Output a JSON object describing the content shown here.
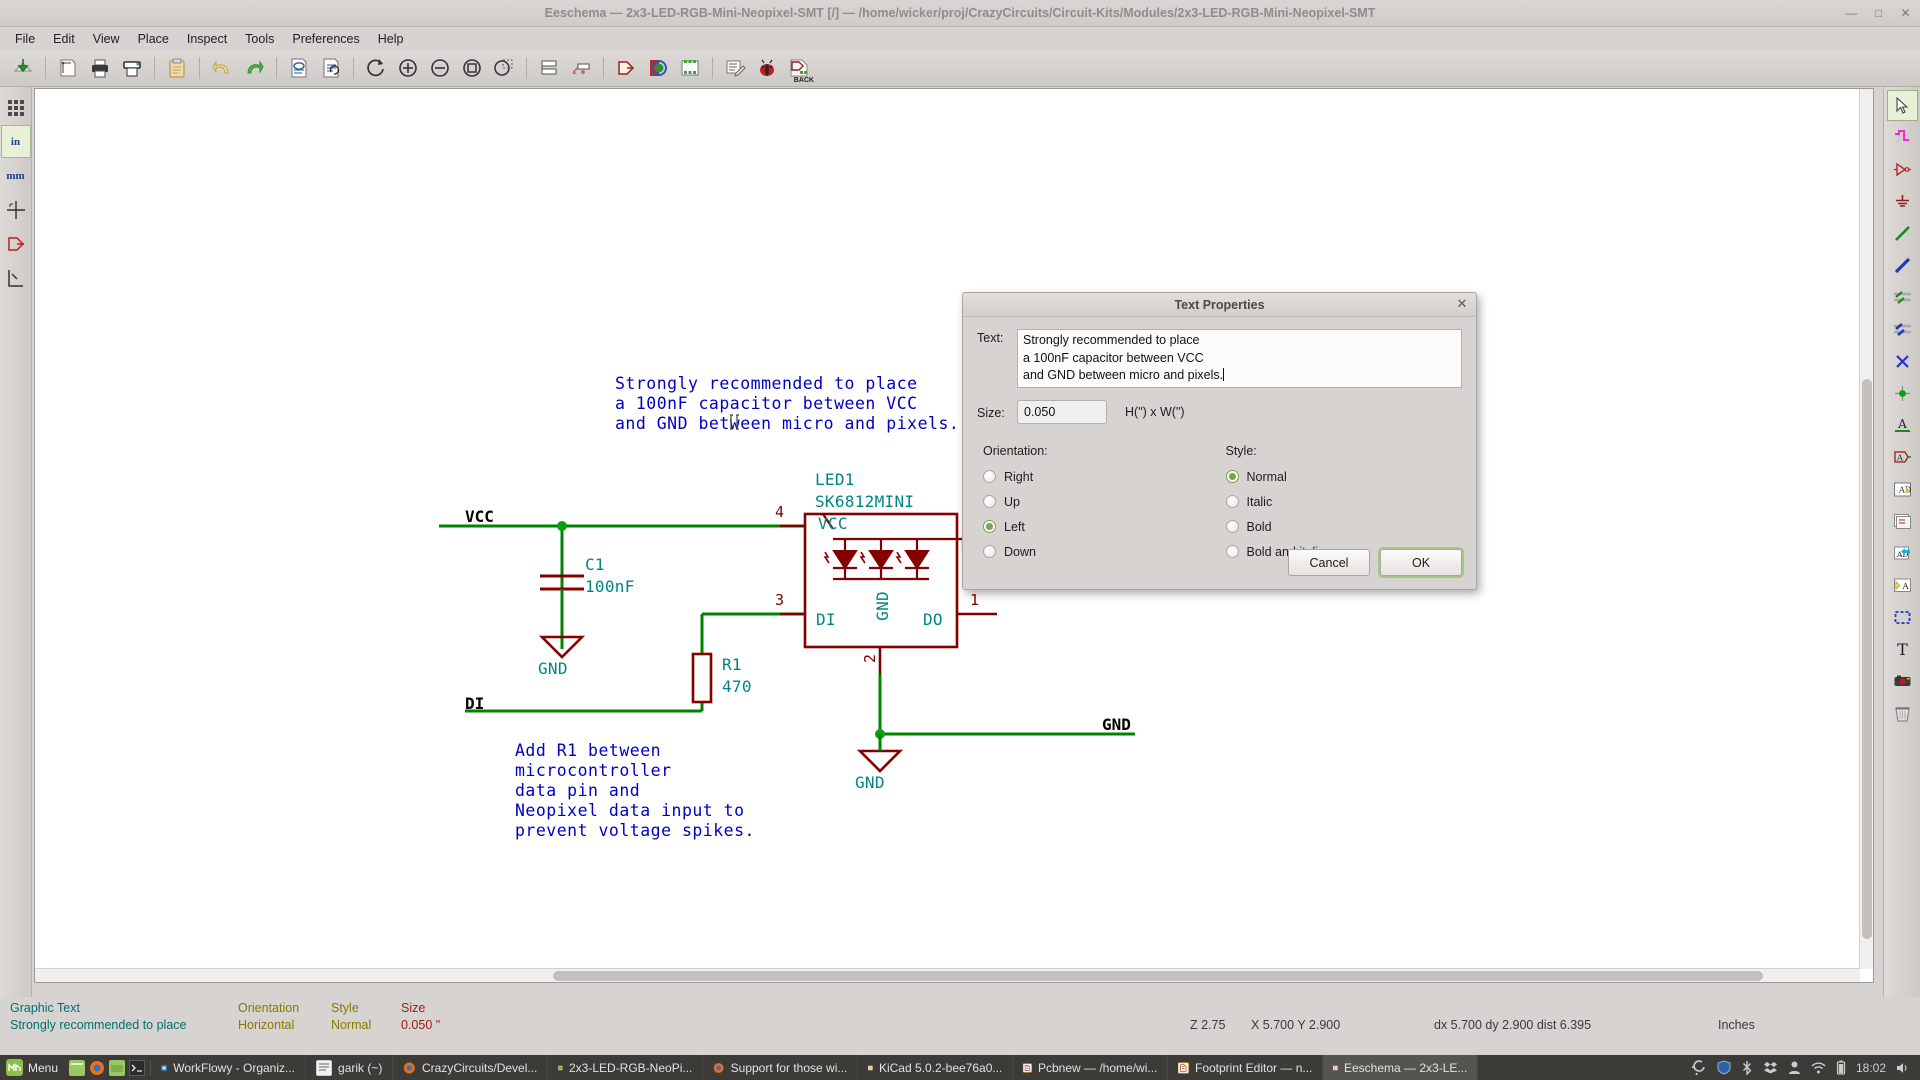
{
  "window": {
    "title": "Eeschema — 2x3-LED-RGB-Mini-Neopixel-SMT [/] — /home/wicker/proj/CrazyCircuits/Circuit-Kits/Modules/2x3-LED-RGB-Mini-Neopixel-SMT",
    "minimize": "—",
    "maximize": "□",
    "close": "✕"
  },
  "menubar": {
    "items": [
      {
        "label": "File"
      },
      {
        "label": "Edit"
      },
      {
        "label": "View"
      },
      {
        "label": "Place"
      },
      {
        "label": "Inspect"
      },
      {
        "label": "Tools"
      },
      {
        "label": "Preferences"
      },
      {
        "label": "Help"
      }
    ]
  },
  "toolbar": {
    "buttons": [
      {
        "name": "new-sheet-icon",
        "tip": "New Schematic"
      },
      {
        "name": "page-settings-icon",
        "tip": "Page Settings"
      },
      {
        "name": "print-icon",
        "tip": "Print Schematic"
      },
      {
        "name": "plot-icon",
        "tip": "Plot Schematic"
      },
      {
        "name": "paste-icon",
        "tip": "Paste"
      },
      {
        "name": "undo-icon",
        "tip": "Undo"
      },
      {
        "name": "redo-icon",
        "tip": "Redo"
      },
      {
        "name": "find-icon",
        "tip": "Find Items"
      },
      {
        "name": "find-replace-icon",
        "tip": "Find and Replace"
      },
      {
        "name": "refresh-icon",
        "tip": "Refresh"
      },
      {
        "name": "zoom-in-icon",
        "tip": "Zoom In"
      },
      {
        "name": "zoom-out-icon",
        "tip": "Zoom Out"
      },
      {
        "name": "zoom-fit-icon",
        "tip": "Fit on Screen"
      },
      {
        "name": "zoom-area-icon",
        "tip": "Zoom to Selection"
      },
      {
        "name": "hierarchy-icon",
        "tip": "Navigate Hierarchy"
      },
      {
        "name": "leave-sheet-icon",
        "tip": "Leave Sheet"
      },
      {
        "name": "annotate-icon",
        "tip": "Annotate Schematic"
      },
      {
        "name": "erc-icon",
        "tip": "Electrical Rules Check"
      },
      {
        "name": "netlist-icon",
        "tip": "Generate Netlist"
      },
      {
        "name": "bom-icon",
        "tip": "Bill of Materials"
      },
      {
        "name": "cvpcb-icon",
        "tip": "Assign Footprints"
      },
      {
        "name": "pcbnew-icon",
        "tip": "Run Pcbnew"
      },
      {
        "name": "back-annotate-icon",
        "tip": "Back Annotate",
        "label": "BACK"
      }
    ]
  },
  "left_toolbar": {
    "buttons": [
      {
        "name": "toggle-grid-icon",
        "text": ""
      },
      {
        "name": "units-inches-button",
        "text": "in"
      },
      {
        "name": "units-mm-button",
        "text": "mm"
      },
      {
        "name": "cursor-shape-icon",
        "text": ""
      },
      {
        "name": "hidden-pins-icon",
        "text": ""
      },
      {
        "name": "bus-wire-entry-icon",
        "text": ""
      }
    ]
  },
  "right_toolbar": {
    "buttons": [
      {
        "name": "select-tool",
        "selected": true
      },
      {
        "name": "place-hierarchical-pin-tool",
        "selected": false
      },
      {
        "name": "place-symbol-tool",
        "selected": false
      },
      {
        "name": "place-power-port-tool",
        "selected": false
      },
      {
        "name": "place-wire-tool",
        "selected": false
      },
      {
        "name": "place-bus-tool",
        "selected": false
      },
      {
        "name": "place-wire-to-bus-entry-tool",
        "selected": false
      },
      {
        "name": "place-bus-to-bus-entry-tool",
        "selected": false
      },
      {
        "name": "place-no-connect-tool",
        "selected": false
      },
      {
        "name": "place-junction-tool",
        "selected": false
      },
      {
        "name": "place-net-label-tool",
        "selected": false
      },
      {
        "name": "place-global-label-tool",
        "selected": false
      },
      {
        "name": "place-hierarchical-label-tool",
        "selected": false
      },
      {
        "name": "place-hierarchical-sheet-tool",
        "selected": false
      },
      {
        "name": "import-sheet-pin-tool",
        "selected": false
      },
      {
        "name": "place-sheet-pin-tool",
        "selected": false
      },
      {
        "name": "place-graphic-box-tool",
        "selected": false
      },
      {
        "name": "place-text-tool",
        "selected": false
      },
      {
        "name": "place-image-tool",
        "selected": false
      },
      {
        "name": "delete-tool",
        "selected": false
      }
    ]
  },
  "schematic": {
    "notes": [
      {
        "id": "note-capacitor",
        "text": "Strongly recommended to place\na 100nF capacitor between VCC\nand GND between micro and pixels.",
        "color": "#0000c4"
      },
      {
        "id": "note-resistor",
        "text": "Add R1 between\nmicrocontroller\ndata pin and\nNeopixel data input to\nprevent voltage spikes.",
        "color": "#0000c4"
      }
    ],
    "net_labels": [
      {
        "name": "net-label-vcc",
        "text": "VCC"
      },
      {
        "name": "net-label-di",
        "text": "DI"
      },
      {
        "name": "net-label-gnd-right",
        "text": "GND"
      }
    ],
    "components": [
      {
        "ref": "C1",
        "value": "100nF"
      },
      {
        "ref": "R1",
        "value": "470"
      },
      {
        "ref": "LED1",
        "value": "SK6812MINI"
      }
    ],
    "power_ports": [
      {
        "name": "power-port-gnd-c1",
        "text": "GND"
      },
      {
        "name": "power-port-gnd-led",
        "text": "GND"
      }
    ],
    "ic_pins": [
      {
        "num": "4",
        "label": "VCC"
      },
      {
        "num": "3",
        "label": "DI"
      },
      {
        "num": "2",
        "label": "GND"
      },
      {
        "num": "1",
        "label": "DO"
      }
    ],
    "colors": {
      "wire": "#008400",
      "component": "#840000",
      "field": "#008484",
      "note": "#0000c4",
      "label": "#000000"
    }
  },
  "dialog": {
    "title": "Text Properties",
    "close": "✕",
    "text_label": "Text:",
    "text_value": "Strongly recommended to place\na 100nF capacitor between VCC\nand GND between micro and pixels.",
    "size_label": "Size:",
    "size_value": "0.050",
    "size_units": "H(\") x W(\")",
    "orientation_label": "Orientation:",
    "orientation_options": [
      {
        "label": "Right",
        "selected": false
      },
      {
        "label": "Up",
        "selected": false
      },
      {
        "label": "Left",
        "selected": true
      },
      {
        "label": "Down",
        "selected": false
      }
    ],
    "style_label": "Style:",
    "style_options": [
      {
        "label": "Normal",
        "selected": true
      },
      {
        "label": "Italic",
        "selected": false
      },
      {
        "label": "Bold",
        "selected": false
      },
      {
        "label": "Bold and italic",
        "selected": false
      }
    ],
    "cancel_label": "Cancel",
    "ok_label": "OK",
    "accent": "#7ca34b"
  },
  "statusbar": {
    "item_type": "Graphic Text",
    "item_text": "Strongly recommended to place",
    "orientation_header": "Orientation",
    "orientation_value": "Horizontal",
    "style_header": "Style",
    "style_value": "Normal",
    "size_header": "Size",
    "size_value": "0.050 \"",
    "zoom": "Z 2.75",
    "coords": "X 5.700  Y 2.900",
    "delta": "dx 5.700  dy 2.900  dist 6.395",
    "units": "Inches"
  },
  "taskbar": {
    "menu_label": "Menu",
    "launchers": [
      {
        "name": "launcher-files-icon"
      },
      {
        "name": "launcher-firefox-icon"
      },
      {
        "name": "launcher-filemanager-icon"
      },
      {
        "name": "launcher-terminal-icon"
      }
    ],
    "windows": [
      {
        "label": "WorkFlowy - Organiz...",
        "icon": "firefox-window-icon",
        "active": false
      },
      {
        "label": "garik (~)",
        "icon": "terminal-window-icon",
        "active": false
      },
      {
        "label": "CrazyCircuits/Devel...",
        "icon": "firefox-window-icon",
        "active": false
      },
      {
        "label": "2x3-LED-RGB-NeoPi...",
        "icon": "folder-window-icon",
        "active": false
      },
      {
        "label": "Support for those wi...",
        "icon": "firefox-window-icon",
        "active": false
      },
      {
        "label": "KiCad 5.0.2-bee76a0...",
        "icon": "kicad-window-icon",
        "active": false
      },
      {
        "label": "Pcbnew — /home/wi...",
        "icon": "kicad-window-icon",
        "active": false
      },
      {
        "label": "Footprint Editor — n...",
        "icon": "kicad-window-icon",
        "active": false
      },
      {
        "label": "Eeschema — 2x3-LE...",
        "icon": "kicad-window-icon",
        "active": true
      }
    ],
    "tray": [
      {
        "name": "tray-updates-icon"
      },
      {
        "name": "tray-shield-icon"
      },
      {
        "name": "tray-bluetooth-icon"
      },
      {
        "name": "tray-dropbox-icon"
      },
      {
        "name": "tray-user-icon"
      },
      {
        "name": "tray-network-icon"
      },
      {
        "name": "tray-battery-icon"
      }
    ],
    "clock": "18:02",
    "volume_icon": "tray-volume-icon"
  }
}
